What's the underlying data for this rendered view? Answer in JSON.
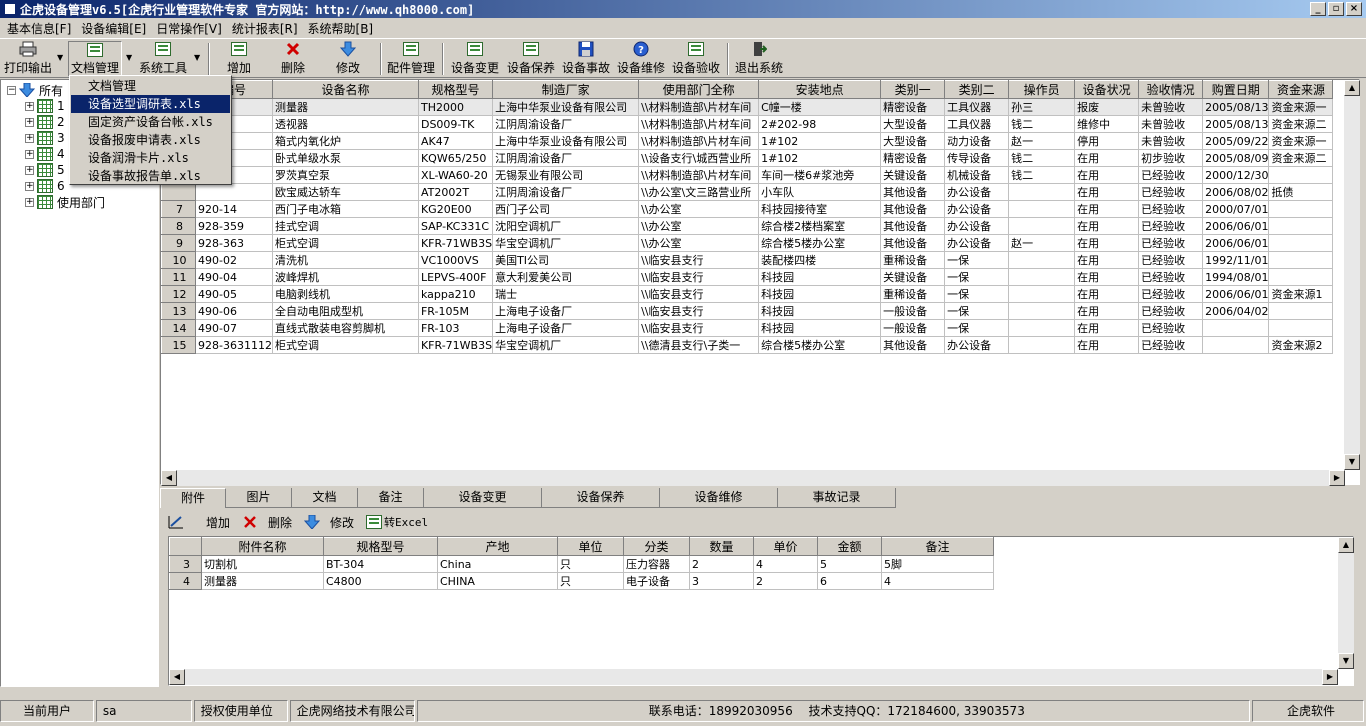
{
  "window": {
    "title": "企虎设备管理v6.5[企虎行业管理软件专家 官方网站：http://www.qh8000.com]",
    "minimize": "_",
    "restore": "▫",
    "close": "×"
  },
  "menubar": [
    "基本信息[F]",
    "设备编辑[E]",
    "日常操作[V]",
    "统计报表[R]",
    "系统帮助[B]"
  ],
  "toolbar": {
    "print": "打印输出",
    "docs": "文档管理",
    "systools": "系统工具",
    "add": "增加",
    "delete": "删除",
    "modify": "修改",
    "parts": "配件管理",
    "change": "设备变更",
    "maintain": "设备保养",
    "accident": "设备事故",
    "repair": "设备维修",
    "accept": "设备验收",
    "exit": "退出系统"
  },
  "dropdown": {
    "items": [
      "文档管理",
      "设备选型调研表.xls",
      "固定资产设备台帐.xls",
      "设备报废申请表.xls",
      "设备润滑卡片.xls",
      "设备事故报告单.xls"
    ],
    "selected_index": 1
  },
  "tree": {
    "root_label": "所有",
    "child_labels": [
      "1",
      "2",
      "3",
      "4",
      "5",
      "6"
    ],
    "dept_label": "使用部门"
  },
  "main_table": {
    "headers": [
      "编号",
      "设备名称",
      "规格型号",
      "制造厂家",
      "使用部门全称",
      "安装地点",
      "类别一",
      "类别二",
      "操作员",
      "设备状况",
      "验收情况",
      "购置日期",
      "资金来源"
    ],
    "rows": [
      [
        "",
        "",
        "测量器",
        "TH2000",
        "上海中华泵业设备有限公司",
        "\\\\材料制造部\\片材车间",
        "C幢一楼",
        "精密设备",
        "工具仪器",
        "孙三",
        "报废",
        "未曾验收",
        "2005/08/13",
        "资金来源一"
      ],
      [
        "",
        "",
        "透视器",
        "DS009-TK",
        "江阴周渝设备厂",
        "\\\\材料制造部\\片材车间",
        "2#202-98",
        "大型设备",
        "工具仪器",
        "钱二",
        "维修中",
        "未曾验收",
        "2005/08/13",
        "资金来源二"
      ],
      [
        "",
        "",
        "箱式内氧化炉",
        "AK47",
        "上海中华泵业设备有限公司",
        "\\\\材料制造部\\片材车间",
        "1#102",
        "大型设备",
        "动力设备",
        "赵一",
        "停用",
        "未曾验收",
        "2005/09/22",
        "资金来源一"
      ],
      [
        "",
        "",
        "卧式单级水泵",
        "KQW65/250",
        "江阴周渝设备厂",
        "\\\\设备支行\\城西营业所",
        "1#102",
        "精密设备",
        "传导设备",
        "钱二",
        "在用",
        "初步验收",
        "2005/08/09",
        "资金来源二"
      ],
      [
        "",
        "",
        "罗茨真空泵",
        "XL-WA60-20",
        "无锡泵业有限公司",
        "\\\\材料制造部\\片材车间",
        "车间一楼6#浆池旁",
        "关键设备",
        "机械设备",
        "钱二",
        "在用",
        "已经验收",
        "2000/12/30",
        ""
      ],
      [
        "",
        "",
        "欧宝威达轿车",
        "AT2002T",
        "江阴周渝设备厂",
        "\\\\办公室\\文三路营业所",
        "小车队",
        "其他设备",
        "办公设备",
        "",
        "在用",
        "已经验收",
        "2006/08/02",
        "抵债"
      ],
      [
        "7",
        "920-14",
        "西门子电冰箱",
        "KG20E00",
        "西门子公司",
        "\\\\办公室",
        "科技园接待室",
        "其他设备",
        "办公设备",
        "",
        "在用",
        "已经验收",
        "2000/07/01",
        ""
      ],
      [
        "8",
        "928-359",
        "挂式空调",
        "SAP-KC331C",
        "沈阳空调机厂",
        "\\\\办公室",
        "综合楼2楼档案室",
        "其他设备",
        "办公设备",
        "",
        "在用",
        "已经验收",
        "2006/06/01",
        ""
      ],
      [
        "9",
        "928-363",
        "柜式空调",
        "KFR-71WB3S",
        "华宝空调机厂",
        "\\\\办公室",
        "综合楼5楼办公室",
        "其他设备",
        "办公设备",
        "赵一",
        "在用",
        "已经验收",
        "2006/06/01",
        ""
      ],
      [
        "10",
        "490-02",
        "清洗机",
        "VC1000VS",
        "美国TI公司",
        "\\\\临安县支行",
        "装配楼四楼",
        "重稀设备",
        "一保",
        "",
        "在用",
        "已经验收",
        "1992/11/01",
        ""
      ],
      [
        "11",
        "490-04",
        "波峰焊机",
        "LEPVS-400F",
        "意大利爱美公司",
        "\\\\临安县支行",
        "科技园",
        "关键设备",
        "一保",
        "",
        "在用",
        "已经验收",
        "1994/08/01",
        ""
      ],
      [
        "12",
        "490-05",
        "电脑剥线机",
        "kappa210",
        "瑞士",
        "\\\\临安县支行",
        "科技园",
        "重稀设备",
        "一保",
        "",
        "在用",
        "已经验收",
        "2006/06/01",
        "资金来源1"
      ],
      [
        "13",
        "490-06",
        "全自动电阻成型机",
        "FR-105M",
        "上海电子设备厂",
        "\\\\临安县支行",
        "科技园",
        "一般设备",
        "一保",
        "",
        "在用",
        "已经验收",
        "2006/04/02",
        ""
      ],
      [
        "14",
        "490-07",
        "直线式散装电容剪脚机",
        "FR-103",
        "上海电子设备厂",
        "\\\\临安县支行",
        "科技园",
        "一般设备",
        "一保",
        "",
        "在用",
        "已经验收",
        "",
        ""
      ],
      [
        "15",
        "928-3631112",
        "柜式空调",
        "KFR-71WB3S",
        "华宝空调机厂",
        "\\\\德清县支行\\子类一",
        "综合楼5楼办公室",
        "其他设备",
        "办公设备",
        "",
        "在用",
        "已经验收",
        "",
        "资金来源2"
      ]
    ]
  },
  "tabs": [
    "附件",
    "图片",
    "文档",
    "备注",
    "设备变更",
    "设备保养",
    "设备维修",
    "事故记录"
  ],
  "sub_toolbar": {
    "add": "增加",
    "delete": "删除",
    "modify": "修改",
    "to_excel": "转Excel"
  },
  "sub_table": {
    "headers": [
      "附件名称",
      "规格型号",
      "产地",
      "单位",
      "分类",
      "数量",
      "单价",
      "金额",
      "备注"
    ],
    "rows": [
      [
        "3",
        "切割机",
        "BT-304",
        "China",
        "只",
        "压力容器",
        "2",
        "4",
        "5",
        "5脚"
      ],
      [
        "4",
        "测量器",
        "C4800",
        "CHINA",
        "只",
        "电子设备",
        "3",
        "2",
        "6",
        "4"
      ]
    ]
  },
  "statusbar": {
    "user_label": "当前用户",
    "user_value": "sa",
    "license_label": "授权使用单位",
    "license_value": "企虎网络技术有限公司",
    "contact": "联系电话：18992030956　 技术支持QQ：172184600, 33903573",
    "brand": "企虎软件"
  }
}
